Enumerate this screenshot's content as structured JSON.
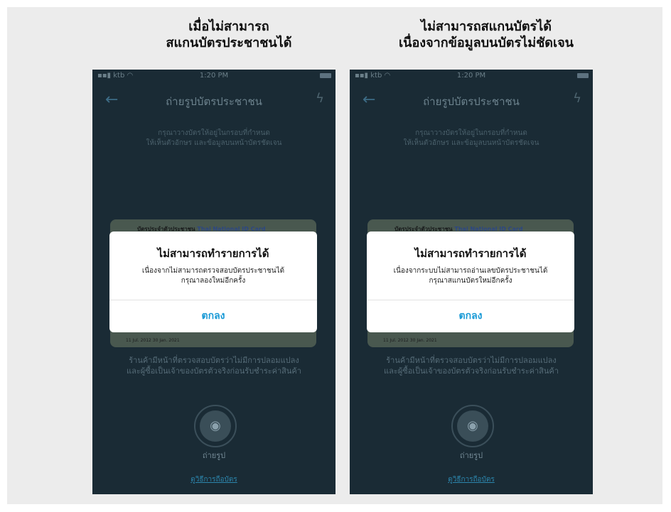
{
  "panels": [
    {
      "caption": {
        "line1": "เมื่อไม่สามารถ",
        "line2": "สแกนบัตรประชาชนได้"
      },
      "status_bar": {
        "carrier": "ktb",
        "time": "1:20 PM"
      },
      "nav": {
        "title": "ถ่ายรูปบัตรประชาชน"
      },
      "instruction": {
        "line1": "กรุณาวางบัตรให้อยู่ในกรอบที่กำหนด",
        "line2": "ให้เห็นตัวอักษร และข้อมูลบนหน้าบัตรชัดเจน"
      },
      "idcard": {
        "title_th": "บัตรประจำตัวประชาชน",
        "title_en": "Thai National ID Card",
        "bottom": "11 Jul. 2012   30 Jan. 2021"
      },
      "warning": {
        "line1": "ร้านค้ามีหน้าที่ตรวจสอบบัตรว่าไม่มีการปลอมแปลง",
        "line2": "และผู้ซื้อเป็นเจ้าของบัตรตัวจริงก่อนรับชำระค่าสินค้า"
      },
      "shutter_label": "ถ่ายรูป",
      "howto_link": "ดูวิธีการถือบัตร",
      "dialog": {
        "title": "ไม่สามารถทำรายการได้",
        "message1": "เนื่องจากไม่สามารถตรวจสอบบัตรประชาชนได้",
        "message2": "กรุณาลองใหม่อีกครั้ง",
        "ok": "ตกลง"
      }
    },
    {
      "caption": {
        "line1": "ไม่สามารถสแกนบัตรได้",
        "line2": "เนื่องจากข้อมูลบนบัตรไม่ชัดเจน"
      },
      "status_bar": {
        "carrier": "ktb",
        "time": "1:20 PM"
      },
      "nav": {
        "title": "ถ่ายรูปบัตรประชาชน"
      },
      "instruction": {
        "line1": "กรุณาวางบัตรให้อยู่ในกรอบที่กำหนด",
        "line2": "ให้เห็นตัวอักษร และข้อมูลบนหน้าบัตรชัดเจน"
      },
      "idcard": {
        "title_th": "บัตรประจำตัวประชาชน",
        "title_en": "Thai National ID Card",
        "bottom": "11 Jul. 2012   30 Jan. 2021"
      },
      "warning": {
        "line1": "ร้านค้ามีหน้าที่ตรวจสอบบัตรว่าไม่มีการปลอมแปลง",
        "line2": "และผู้ซื้อเป็นเจ้าของบัตรตัวจริงก่อนรับชำระค่าสินค้า"
      },
      "shutter_label": "ถ่ายรูป",
      "howto_link": "ดูวิธีการถือบัตร",
      "dialog": {
        "title": "ไม่สามารถทำรายการได้",
        "message1": "เนื่องจากระบบไม่สามารถอ่านเลขบัตรประชาชนได้",
        "message2": "กรุณาสแกนบัตรใหม่อีกครั้ง",
        "ok": "ตกลง"
      }
    }
  ],
  "icons": {
    "back": "back-arrow-icon",
    "flash": "flash-off-icon",
    "camera": "camera-icon",
    "signal": "signal-icon",
    "wifi": "wifi-icon",
    "battery": "battery-icon"
  }
}
